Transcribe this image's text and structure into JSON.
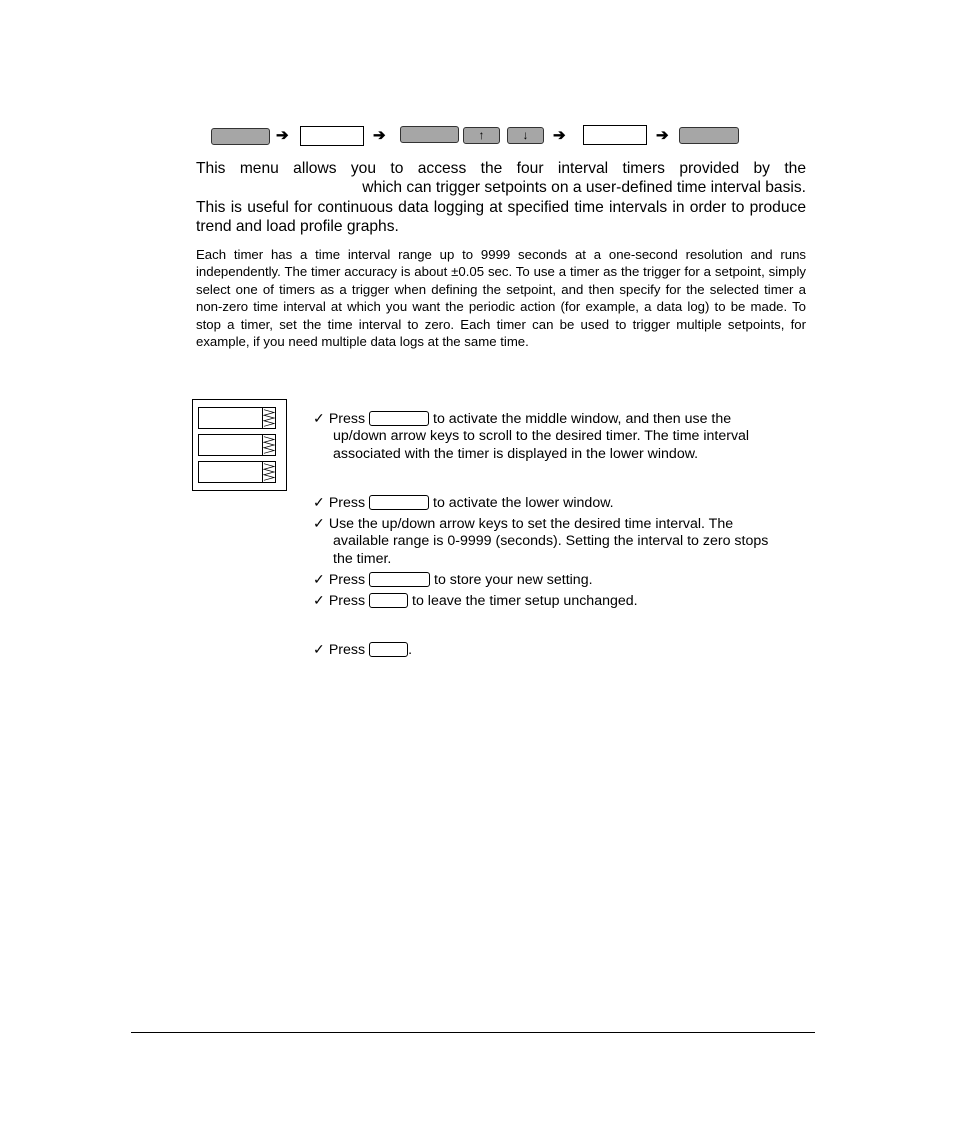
{
  "key_sequence": {
    "keys": [
      {
        "type": "gray-key",
        "label": ""
      },
      {
        "type": "arrow",
        "label": "➔"
      },
      {
        "type": "display-window",
        "label": ""
      },
      {
        "type": "arrow",
        "label": "➔"
      },
      {
        "type": "gray-key",
        "label": ""
      },
      {
        "type": "gray-key",
        "label": "🡑"
      },
      {
        "type": "gray-key",
        "label": "🡓"
      },
      {
        "type": "arrow",
        "label": "➔"
      },
      {
        "type": "display-window",
        "label": ""
      },
      {
        "type": "arrow",
        "label": "➔"
      },
      {
        "type": "gray-key",
        "label": ""
      }
    ],
    "up_glyph": "↑",
    "down_glyph": "↓",
    "arrow_glyph": "➔"
  },
  "intro": {
    "line1": "This menu allows you to access the four interval timers provided by the",
    "line2": "which can trigger setpoints on a user-defined time interval basis.",
    "line3": "This is useful for continuous data logging at specified time intervals in order to produce trend and load profile graphs."
  },
  "detail": {
    "text": "Each timer has a time interval range up to 9999 seconds at a one-second resolution and runs independently. The timer accuracy is about ±0.05 sec. To use a timer as the trigger for a setpoint, simply select one of timers as a trigger when defining the setpoint, and then specify for the selected timer a non-zero time interval at which you want the periodic action (for example, a data log) to be made. To stop a timer, set the time interval to zero. Each timer can be used to trigger multiple setpoints, for example, if you need multiple data logs at the same time."
  },
  "steps": {
    "check": "✓",
    "s1": {
      "press": "Press",
      "line1": "to activate the middle window, and then use the",
      "line2": "up/down arrow keys to scroll to the desired timer. The time interval",
      "line3": "associated with the timer is displayed in the lower window."
    },
    "s2": {
      "press": "Press",
      "text": "to activate the lower window."
    },
    "s3": {
      "line1": "Use the up/down arrow keys to set the desired time interval. The",
      "line2": "available range is 0-9999 (seconds). Setting the interval to zero stops",
      "line3": "the timer."
    },
    "s4": {
      "press": "Press",
      "text": "to store your new setting."
    },
    "s5": {
      "press": "Press",
      "text": "to leave the timer setup unchanged."
    },
    "s6": {
      "press": "Press",
      "text": "."
    }
  }
}
